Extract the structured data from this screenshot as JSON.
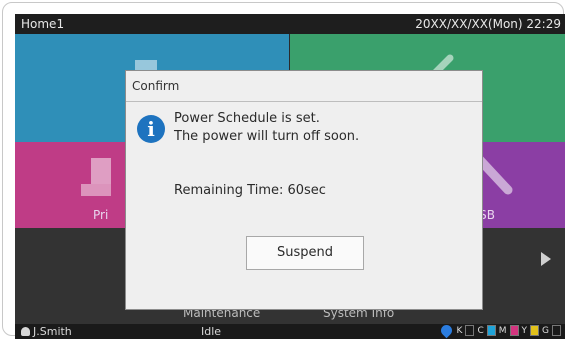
{
  "header": {
    "title": "Home1",
    "datetime": "20XX/XX/XX(Mon) 22:29"
  },
  "tiles": {
    "print_label": "Pri",
    "usb_label": "SB"
  },
  "lower": {
    "maintenance": "Maintenance",
    "system_info": "System Info"
  },
  "status": {
    "user": "J.Smith",
    "state": "Idle",
    "toner": [
      {
        "label": "K",
        "color": "#1a1a1a"
      },
      {
        "label": "C",
        "color": "#1fa3d8"
      },
      {
        "label": "M",
        "color": "#d3357f"
      },
      {
        "label": "Y",
        "color": "#e2c21b"
      },
      {
        "label": "G",
        "color": "#1a1a1a"
      }
    ]
  },
  "dialog": {
    "title": "Confirm",
    "message_line1": "Power Schedule is set.",
    "message_line2": "The power will turn off soon.",
    "remaining": "Remaining Time: 60sec",
    "suspend_label": "Suspend"
  },
  "colors": {
    "accent": "#1e73bf",
    "copy": "#2f8fb8",
    "scan": "#3aa06c",
    "print": "#bf3c86",
    "usb": "#8b3ea4"
  }
}
